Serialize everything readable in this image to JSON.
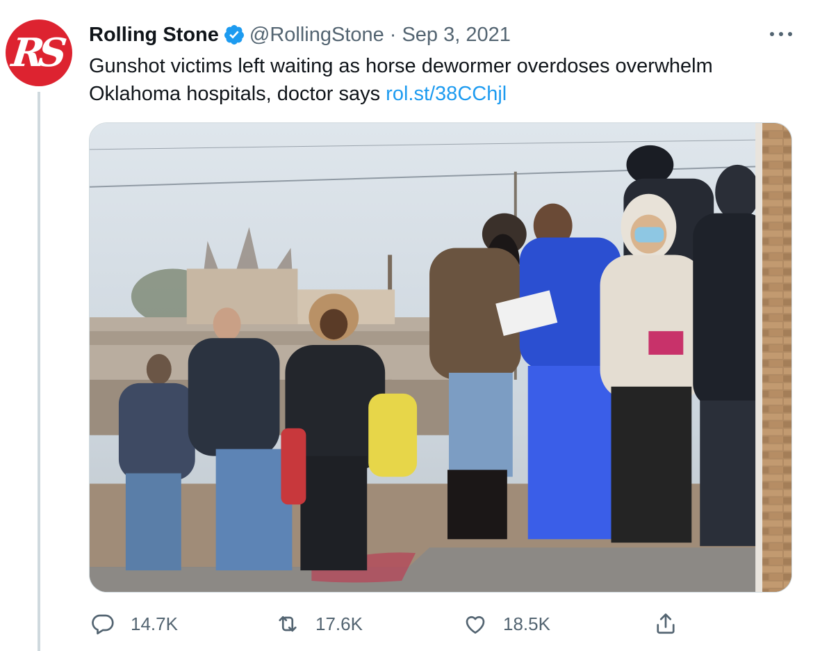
{
  "tweet": {
    "avatar_text": "RS",
    "author_name": "Rolling Stone",
    "handle": "@RollingStone",
    "separator": "·",
    "date": "Sep 3, 2021",
    "text": "Gunshot victims left waiting as horse dewormer overdoses overwhelm Oklahoma hospitals, doctor says ",
    "link": "rol.st/38CChjl"
  },
  "actions": {
    "replies": "14.7K",
    "retweets": "17.6K",
    "likes": "18.5K"
  },
  "colors": {
    "brand_red": "#dd2330",
    "verified_blue": "#1d9bf0",
    "link_blue": "#1d9bf0",
    "secondary_text": "#536471"
  },
  "icons": [
    "more-icon",
    "verified-badge-icon",
    "reply-icon",
    "retweet-icon",
    "like-icon",
    "share-icon"
  ]
}
